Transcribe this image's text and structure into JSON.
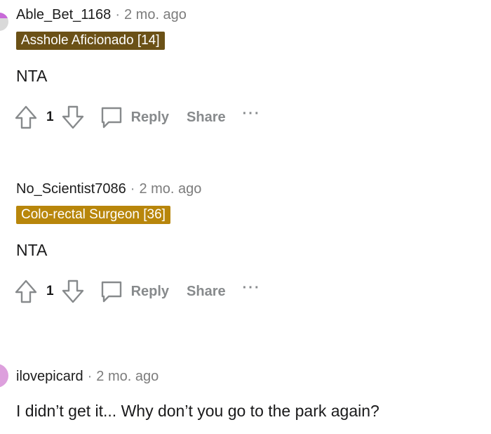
{
  "comments": [
    {
      "username": "Able_Bet_1168",
      "separator": "·",
      "time": "2 mo. ago",
      "flair": "Asshole Aficionado [14]",
      "flair_color": "#6b5117",
      "body": "NTA",
      "score": "1",
      "reply_label": "Reply",
      "share_label": "Share",
      "more_label": "···"
    },
    {
      "username": "No_Scientist7086",
      "separator": "·",
      "time": "2 mo. ago",
      "flair": "Colo-rectal Surgeon [36]",
      "flair_color": "#b8860b",
      "body": "NTA",
      "score": "1",
      "reply_label": "Reply",
      "share_label": "Share",
      "more_label": "···"
    },
    {
      "username": "ilovepicard",
      "separator": "·",
      "time": "2 mo. ago",
      "body": "I didn’t get it... Why don’t you go to the park again?"
    }
  ],
  "colors": {
    "icon": "#878a8c",
    "avatar1": "#d9d9d9",
    "avatar2": "#b22222",
    "avatar3": "#dda0dd"
  }
}
